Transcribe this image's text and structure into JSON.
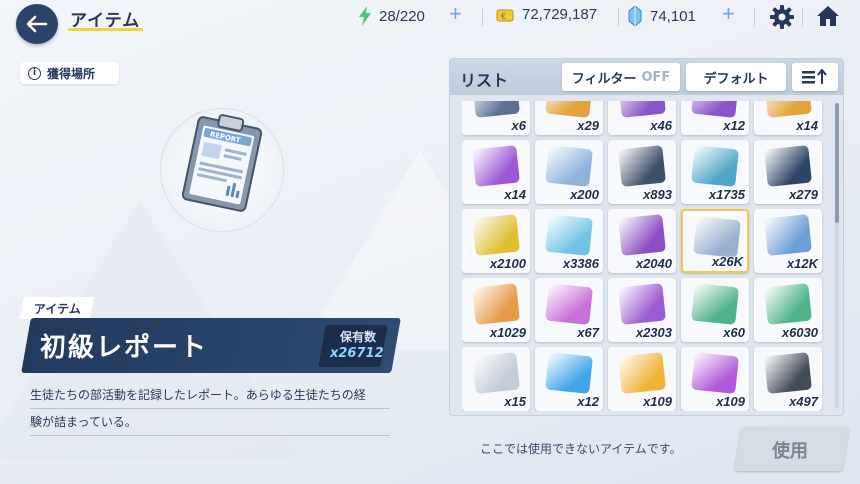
{
  "header": {
    "title": "アイテム",
    "ap": "28/220",
    "credits": "72,729,187",
    "pyroxene": "74,101"
  },
  "left": {
    "acquisition_label": "獲得場所",
    "item_tag": "アイテム",
    "item_name": "初級レポート",
    "owned_label": "保有数",
    "owned_count": "x26712",
    "description_line1": "生徒たちの部活動を記録したレポート。あらゆる生徒たちの経",
    "description_line2": "験が詰まっている。"
  },
  "panel": {
    "list_label": "リスト",
    "filter_label": "フィルター",
    "filter_state": "OFF",
    "sort_label": "デフォルト",
    "rows": [
      [
        {
          "count": "x6",
          "color": "#5a6f93"
        },
        {
          "count": "x29",
          "color": "#e3a23a"
        },
        {
          "count": "x46",
          "color": "#8b55c9"
        },
        {
          "count": "x12",
          "color": "#8b55c9"
        },
        {
          "count": "x14",
          "color": "#e3a23a"
        }
      ],
      [
        {
          "count": "x14",
          "color": "#9a58d6"
        },
        {
          "count": "x200",
          "color": "#8fb4dc"
        },
        {
          "count": "x893",
          "color": "#3e4f68"
        },
        {
          "count": "x1735",
          "color": "#4fa6c8"
        },
        {
          "count": "x279",
          "color": "#2e4466"
        }
      ],
      [
        {
          "count": "x2100",
          "color": "#e0c033"
        },
        {
          "count": "x3386",
          "color": "#6fc4e6"
        },
        {
          "count": "x2040",
          "color": "#8a4fc2"
        },
        {
          "count": "x26K",
          "color": "#9ab0cf"
        },
        {
          "count": "x12K",
          "color": "#6d9fd6"
        }
      ],
      [
        {
          "count": "x1029",
          "color": "#e89a45"
        },
        {
          "count": "x67",
          "color": "#c870d8"
        },
        {
          "count": "x2303",
          "color": "#9c5ad0"
        },
        {
          "count": "x60",
          "color": "#4fb28a"
        },
        {
          "count": "x6030",
          "color": "#4fb28a"
        }
      ],
      [
        {
          "count": "x15",
          "color": "#c3ccd8"
        },
        {
          "count": "x12",
          "color": "#3fa5e8"
        },
        {
          "count": "x109",
          "color": "#f0b43a"
        },
        {
          "count": "x109",
          "color": "#b05ad8"
        },
        {
          "count": "x497",
          "color": "#444c58"
        }
      ]
    ]
  },
  "footer": {
    "unusable_text": "ここでは使用できないアイテムです。",
    "use_label": "使用"
  }
}
